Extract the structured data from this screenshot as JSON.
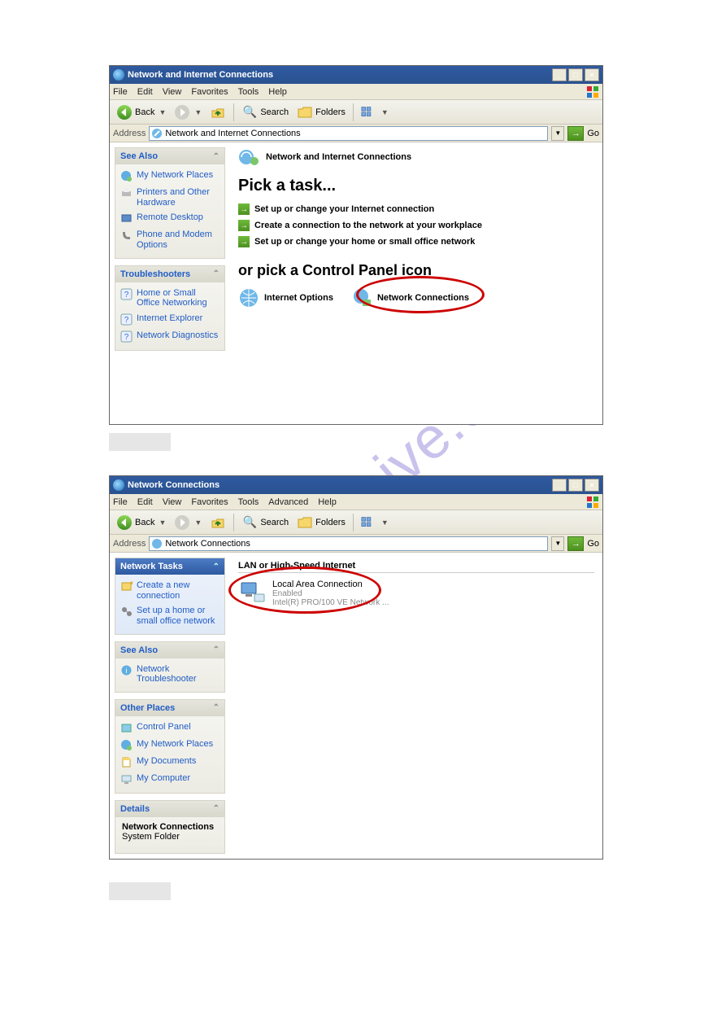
{
  "watermark": "manualshive.com",
  "window1": {
    "title": "Network and Internet Connections",
    "menus": [
      "File",
      "Edit",
      "View",
      "Favorites",
      "Tools",
      "Help"
    ],
    "toolbar": {
      "back": "Back",
      "search": "Search",
      "folders": "Folders"
    },
    "address": {
      "label": "Address",
      "value": "Network and Internet Connections",
      "go": "Go"
    },
    "sidebar": {
      "seeAlso": {
        "title": "See Also",
        "items": [
          "My Network Places",
          "Printers and Other Hardware",
          "Remote Desktop",
          "Phone and Modem Options"
        ]
      },
      "troubleshooters": {
        "title": "Troubleshooters",
        "items": [
          "Home or Small Office Networking",
          "Internet Explorer",
          "Network Diagnostics"
        ]
      }
    },
    "main": {
      "header": "Network and Internet Connections",
      "h1": "Pick a task...",
      "tasks": [
        "Set up or change your Internet connection",
        "Create a connection to the network at your workplace",
        "Set up or change your home or small office network"
      ],
      "h2": "or pick a Control Panel icon",
      "cp": [
        "Internet Options",
        "Network Connections"
      ]
    }
  },
  "window2": {
    "title": "Network Connections",
    "menus": [
      "File",
      "Edit",
      "View",
      "Favorites",
      "Tools",
      "Advanced",
      "Help"
    ],
    "toolbar": {
      "back": "Back",
      "search": "Search",
      "folders": "Folders"
    },
    "address": {
      "label": "Address",
      "value": "Network Connections",
      "go": "Go"
    },
    "sidebar": {
      "networkTasks": {
        "title": "Network Tasks",
        "items": [
          "Create a new connection",
          "Set up a home or small office network"
        ]
      },
      "seeAlso": {
        "title": "See Also",
        "items": [
          "Network Troubleshooter"
        ]
      },
      "otherPlaces": {
        "title": "Other Places",
        "items": [
          "Control Panel",
          "My Network Places",
          "My Documents",
          "My Computer"
        ]
      },
      "details": {
        "title": "Details",
        "name": "Network Connections",
        "type": "System Folder"
      }
    },
    "main": {
      "category": "LAN or High-Speed Internet",
      "conn": {
        "name": "Local Area Connection",
        "status": "Enabled",
        "device": "Intel(R) PRO/100 VE Network ..."
      }
    }
  }
}
